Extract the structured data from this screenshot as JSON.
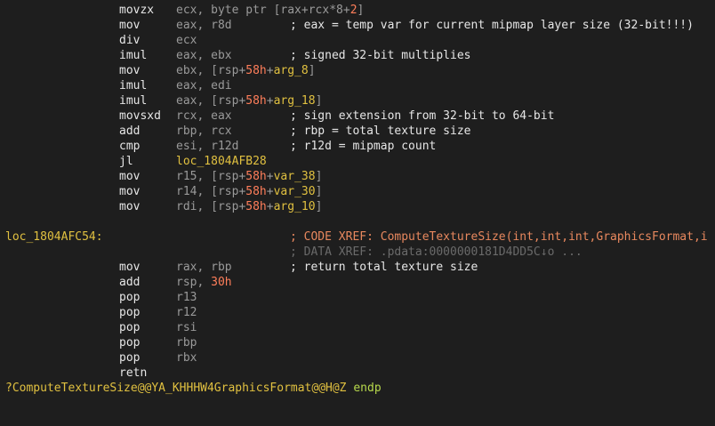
{
  "lines": [
    {
      "mnemonic": "movzx",
      "operands": [
        {
          "t": "reg",
          "v": "ecx, byte ptr ["
        },
        {
          "t": "reg",
          "v": "rax+rcx*8+"
        },
        {
          "t": "num",
          "v": "2"
        },
        {
          "t": "reg",
          "v": "]"
        }
      ],
      "comment": ""
    },
    {
      "mnemonic": "mov",
      "operands": [
        {
          "t": "reg",
          "v": "eax, r8d"
        }
      ],
      "comment": "; eax = temp var for current mipmap layer size (32-bit!!!)"
    },
    {
      "mnemonic": "div",
      "operands": [
        {
          "t": "reg",
          "v": "ecx"
        }
      ],
      "comment": ""
    },
    {
      "mnemonic": "imul",
      "operands": [
        {
          "t": "reg",
          "v": "eax, ebx"
        }
      ],
      "comment": "; signed 32-bit multiplies"
    },
    {
      "mnemonic": "mov",
      "operands": [
        {
          "t": "reg",
          "v": "ebx, [rsp+"
        },
        {
          "t": "num",
          "v": "58h"
        },
        {
          "t": "reg",
          "v": "+"
        },
        {
          "t": "var",
          "v": "arg_8"
        },
        {
          "t": "reg",
          "v": "]"
        }
      ],
      "comment": ""
    },
    {
      "mnemonic": "imul",
      "operands": [
        {
          "t": "reg",
          "v": "eax, edi"
        }
      ],
      "comment": ""
    },
    {
      "mnemonic": "imul",
      "operands": [
        {
          "t": "reg",
          "v": "eax, [rsp+"
        },
        {
          "t": "num",
          "v": "58h"
        },
        {
          "t": "reg",
          "v": "+"
        },
        {
          "t": "var",
          "v": "arg_18"
        },
        {
          "t": "reg",
          "v": "]"
        }
      ],
      "comment": ""
    },
    {
      "mnemonic": "movsxd",
      "operands": [
        {
          "t": "reg",
          "v": "rcx, eax"
        }
      ],
      "comment": "; sign extension from 32-bit to 64-bit"
    },
    {
      "mnemonic": "add",
      "operands": [
        {
          "t": "reg",
          "v": "rbp, rcx"
        }
      ],
      "comment": "; rbp = total texture size"
    },
    {
      "mnemonic": "cmp",
      "operands": [
        {
          "t": "reg",
          "v": "esi, r12d"
        }
      ],
      "comment": "; r12d = mipmap count"
    },
    {
      "mnemonic": "jl",
      "operands": [
        {
          "t": "var",
          "v": "loc_1804AFB28"
        }
      ],
      "comment": ""
    },
    {
      "mnemonic": "mov",
      "operands": [
        {
          "t": "reg",
          "v": "r15, [rsp+"
        },
        {
          "t": "num",
          "v": "58h"
        },
        {
          "t": "reg",
          "v": "+"
        },
        {
          "t": "var",
          "v": "var_38"
        },
        {
          "t": "reg",
          "v": "]"
        }
      ],
      "comment": ""
    },
    {
      "mnemonic": "mov",
      "operands": [
        {
          "t": "reg",
          "v": "r14, [rsp+"
        },
        {
          "t": "num",
          "v": "58h"
        },
        {
          "t": "reg",
          "v": "+"
        },
        {
          "t": "var",
          "v": "var_30"
        },
        {
          "t": "reg",
          "v": "]"
        }
      ],
      "comment": ""
    },
    {
      "mnemonic": "mov",
      "operands": [
        {
          "t": "reg",
          "v": "rdi, [rsp+"
        },
        {
          "t": "num",
          "v": "58h"
        },
        {
          "t": "reg",
          "v": "+"
        },
        {
          "t": "var",
          "v": "arg_10"
        },
        {
          "t": "reg",
          "v": "]"
        }
      ],
      "comment": ""
    }
  ],
  "label": {
    "name": "loc_1804AFC54:",
    "xref_code": "; CODE XREF: ComputeTextureSize(int,int,int,GraphicsFormat,i",
    "xref_data": "; DATA XREF: .pdata:0000000181D4DD5C↓o ..."
  },
  "epilogue": [
    {
      "mnemonic": "mov",
      "operands": [
        {
          "t": "reg",
          "v": "rax, rbp"
        }
      ],
      "comment": "; return total texture size"
    },
    {
      "mnemonic": "add",
      "operands": [
        {
          "t": "reg",
          "v": "rsp, "
        },
        {
          "t": "num",
          "v": "30h"
        }
      ],
      "comment": ""
    },
    {
      "mnemonic": "pop",
      "operands": [
        {
          "t": "reg",
          "v": "r13"
        }
      ],
      "comment": ""
    },
    {
      "mnemonic": "pop",
      "operands": [
        {
          "t": "reg",
          "v": "r12"
        }
      ],
      "comment": ""
    },
    {
      "mnemonic": "pop",
      "operands": [
        {
          "t": "reg",
          "v": "rsi"
        }
      ],
      "comment": ""
    },
    {
      "mnemonic": "pop",
      "operands": [
        {
          "t": "reg",
          "v": "rbp"
        }
      ],
      "comment": ""
    },
    {
      "mnemonic": "pop",
      "operands": [
        {
          "t": "reg",
          "v": "rbx"
        }
      ],
      "comment": ""
    },
    {
      "mnemonic": "retn",
      "operands": [],
      "comment": ""
    }
  ],
  "endp": {
    "name": "?ComputeTextureSize@@YA_KHHHW4GraphicsFormat@@H@Z",
    "keyword": " endp"
  },
  "colors": {
    "background": "#1e1e1e",
    "text": "#e6e6e6",
    "register": "#9a9a9a",
    "number": "#ff7e5a",
    "label": "#e0c040",
    "xref": "#e8885e",
    "endp_keyword": "#b7d84c"
  }
}
